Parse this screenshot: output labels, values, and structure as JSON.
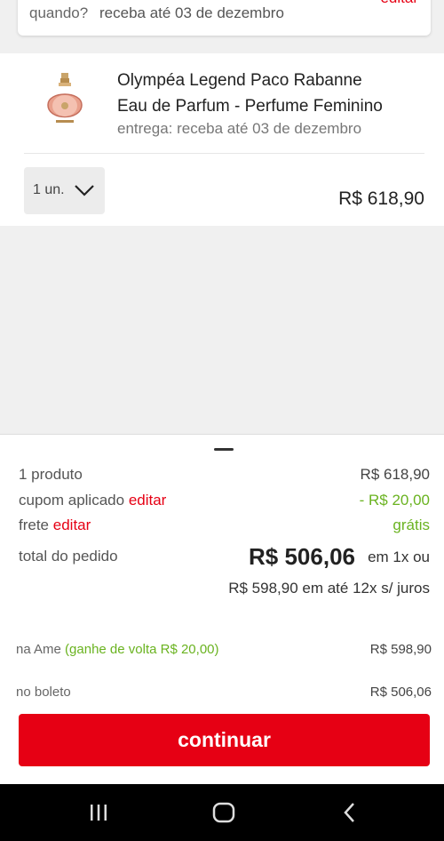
{
  "delivery": {
    "question": "quando?",
    "date_text": "receba até 03 de dezembro",
    "edit_label": "editar"
  },
  "product": {
    "name_line1": "Olympéa Legend Paco Rabanne",
    "name_line2": "Eau de Parfum - Perfume Feminino",
    "delivery_text": "entrega: receba até 03 de dezembro",
    "quantity": "1 un.",
    "price": "R$ 618,90"
  },
  "summary": {
    "products_label": "1 produto",
    "products_value": "R$ 618,90",
    "coupon_label": "cupom aplicado",
    "coupon_edit": "editar",
    "coupon_value": "- R$ 20,00",
    "shipping_label": "frete",
    "shipping_edit": "editar",
    "shipping_value": "grátis",
    "total_label": "total do pedido",
    "total_value": "R$ 506,06",
    "total_suffix": "em 1x ou",
    "installments": "R$ 598,90 em até 12x s/ juros",
    "ame_label": "na Ame",
    "ame_cashback": "(ganhe de volta R$ 20,00)",
    "ame_value": "R$ 598,90",
    "boleto_label": "no boleto",
    "boleto_value": "R$ 506,06",
    "continue_label": "continuar"
  },
  "colors": {
    "accent": "#e60014",
    "cashback": "#6ab320"
  }
}
